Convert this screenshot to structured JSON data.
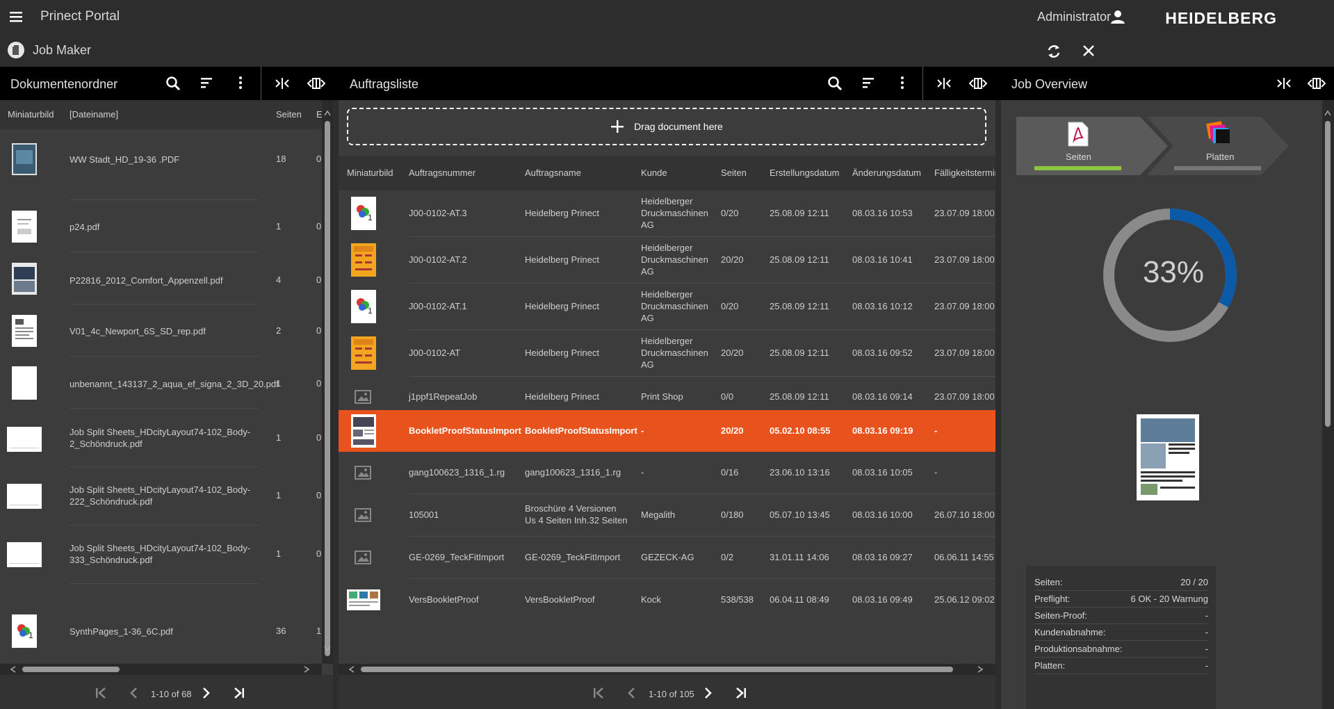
{
  "app": {
    "title": "Prinect Portal",
    "user": "Administrator",
    "brand": "HEIDELBERG",
    "module": "Job Maker"
  },
  "colors": {
    "accent": "#e8531d",
    "green": "#8cc63f",
    "blue": "#0a5aa8",
    "topbar": "#2d2d2d"
  },
  "documents": {
    "title": "Dokumentenordner",
    "columns": {
      "thumb": "Miniaturbild",
      "name": "[Dateiname]",
      "pages": "Seiten",
      "extra": "E"
    },
    "rows": [
      {
        "name": "WW Stadt_HD_19-36 .PDF",
        "pages": "18",
        "extra": "0"
      },
      {
        "name": "p24.pdf",
        "pages": "1",
        "extra": "0"
      },
      {
        "name": "P22816_2012_Comfort_Appenzell.pdf",
        "pages": "4",
        "extra": "0"
      },
      {
        "name": "V01_4c_Newport_6S_SD_rep.pdf",
        "pages": "2",
        "extra": "0"
      },
      {
        "name": "unbenannt_143137_2_aqua_ef_signa_2_3D_20.pdf",
        "pages": "1",
        "extra": "0"
      },
      {
        "name": "Job Split Sheets_HDcityLayout74-102_Body-2_Schöndruck.pdf",
        "pages": "1",
        "extra": "0"
      },
      {
        "name": "Job Split Sheets_HDcityLayout74-102_Body-222_Schöndruck.pdf",
        "pages": "1",
        "extra": "0"
      },
      {
        "name": "Job Split Sheets_HDcityLayout74-102_Body-333_Schöndruck.pdf",
        "pages": "1",
        "extra": "0"
      },
      {
        "name": "SynthPages_1-36_6C.pdf",
        "pages": "36",
        "extra": "1"
      }
    ],
    "pager": "1-10 of 68"
  },
  "jobs": {
    "title": "Auftragsliste",
    "drop_label": "Drag document here",
    "columns": {
      "thumb": "Miniaturbild",
      "number": "Auftragsnummer",
      "name": "Auftragsname",
      "customer": "Kunde",
      "pages": "Seiten",
      "created": "Erstellungsdatum",
      "changed": "Änderungsdatum",
      "due": "Fälligkeitstermin"
    },
    "rows": [
      {
        "number": "J00-0102-AT.3",
        "name": "Heidelberg Prinect",
        "customer": "Heidelberger Druckmaschinen AG",
        "pages": "0/20",
        "created": "25.08.09 12:11",
        "changed": "08.03.16 10:53",
        "due": "23.07.09 18:00"
      },
      {
        "number": "J00-0102-AT.2",
        "name": "Heidelberg Prinect",
        "customer": "Heidelberger Druckmaschinen AG",
        "pages": "20/20",
        "created": "25.08.09 12:11",
        "changed": "08.03.16 10:41",
        "due": "23.07.09 18:00"
      },
      {
        "number": "J00-0102-AT.1",
        "name": "Heidelberg Prinect",
        "customer": "Heidelberger Druckmaschinen AG",
        "pages": "0/20",
        "created": "25.08.09 12:11",
        "changed": "08.03.16 10:12",
        "due": "23.07.09 18:00"
      },
      {
        "number": "J00-0102-AT",
        "name": "Heidelberg Prinect",
        "customer": "Heidelberger Druckmaschinen AG",
        "pages": "20/20",
        "created": "25.08.09 12:11",
        "changed": "08.03.16 09:52",
        "due": "23.07.09 18:00"
      },
      {
        "number": "j1ppf1RepeatJob",
        "name": "Heidelberg Prinect",
        "customer": "Print Shop",
        "pages": "0/0",
        "created": "25.08.09 12:11",
        "changed": "08.03.16 09:14",
        "due": "23.07.09 18:00"
      },
      {
        "number": "BookletProofStatusImport",
        "name": "BookletProofStatusImport",
        "customer": "-",
        "pages": "20/20",
        "created": "05.02.10 08:55",
        "changed": "08.03.16 09:19",
        "due": "-"
      },
      {
        "number": "gang100623_1316_1.rg",
        "name": "gang100623_1316_1.rg",
        "customer": "-",
        "pages": "0/16",
        "created": "23.06.10 13:16",
        "changed": "08.03.16 10:05",
        "due": "-"
      },
      {
        "number": "105001",
        "name": "Broschüre 4 Versionen Us 4 Seiten Inh.32 Seiten",
        "customer": "Megalith",
        "pages": "0/180",
        "created": "05.07.10 13:45",
        "changed": "08.03.16 10:00",
        "due": "26.07.10 18:00"
      },
      {
        "number": "GE-0269_TeckFitImport",
        "name": "GE-0269_TeckFitImport",
        "customer": "GEZECK-AG",
        "pages": "0/2",
        "created": "31.01.11 14:06",
        "changed": "08.03.16 09:27",
        "due": "06.06.11 14:55"
      },
      {
        "number": "VersBookletProof",
        "name": "VersBookletProof",
        "customer": "Kock",
        "pages": "538/538",
        "created": "06.04.11 08:49",
        "changed": "08.03.16 09:49",
        "due": "25.06.12 09:02"
      }
    ],
    "pager": "1-10 of 105"
  },
  "overview": {
    "title": "Job Overview",
    "steps": [
      {
        "label": "Seiten",
        "progress": 1.0
      },
      {
        "label": "Platten",
        "progress": 0.0
      }
    ],
    "percent_label": "33%",
    "percent": 0.33,
    "stats": [
      {
        "key": "Seiten:",
        "value": "20 / 20"
      },
      {
        "key": "Preflight:",
        "value": "6 OK - 20 Warnung"
      },
      {
        "key": "Seiten-Proof:",
        "value": "-"
      },
      {
        "key": "Kundenabnahme:",
        "value": "-"
      },
      {
        "key": "Produktionsabnahme:",
        "value": "-"
      },
      {
        "key": "Platten:",
        "value": "-"
      }
    ]
  }
}
